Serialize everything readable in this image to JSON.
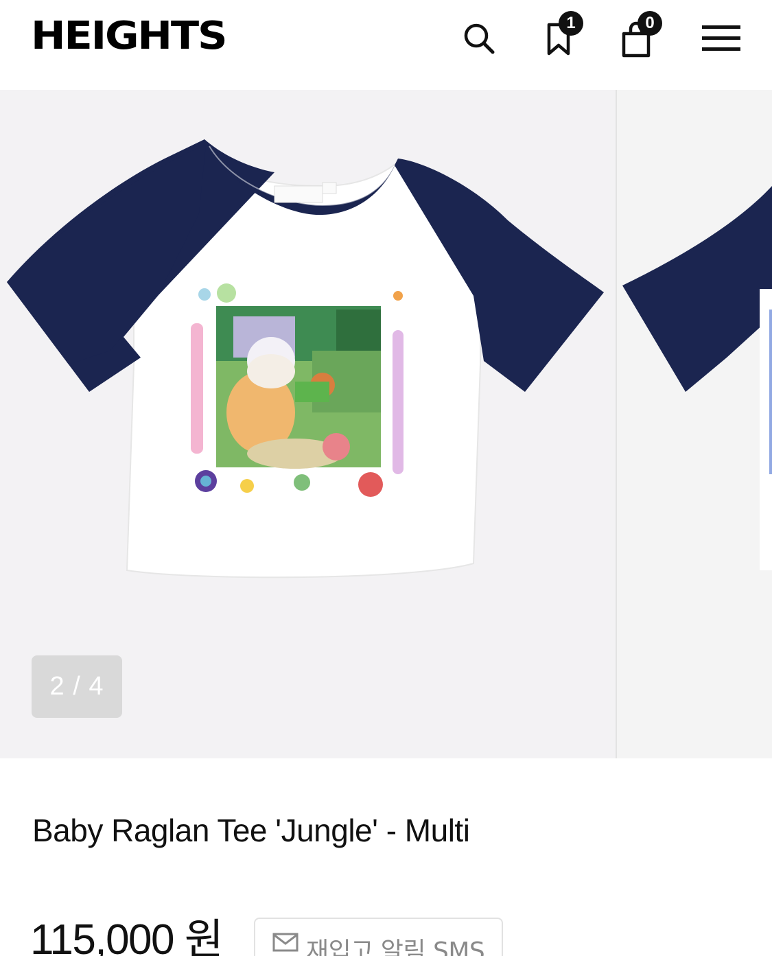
{
  "header": {
    "logo": "HEIGHTS",
    "wishlist_count": "1",
    "cart_count": "0"
  },
  "gallery": {
    "counter": "2 / 4"
  },
  "product": {
    "title": "Baby Raglan Tee 'Jungle' - Multi",
    "price": "115,000 원",
    "restock_label": "재입고 알림 SMS"
  },
  "icons": [
    "search-icon",
    "bookmark-icon",
    "shopping-bag-icon",
    "menu-icon",
    "mail-icon"
  ],
  "colors": {
    "tee_sleeve": "#1b2550",
    "tee_body": "#ffffff",
    "badge": "#111111",
    "gallery_bg": "#f3f2f4"
  }
}
